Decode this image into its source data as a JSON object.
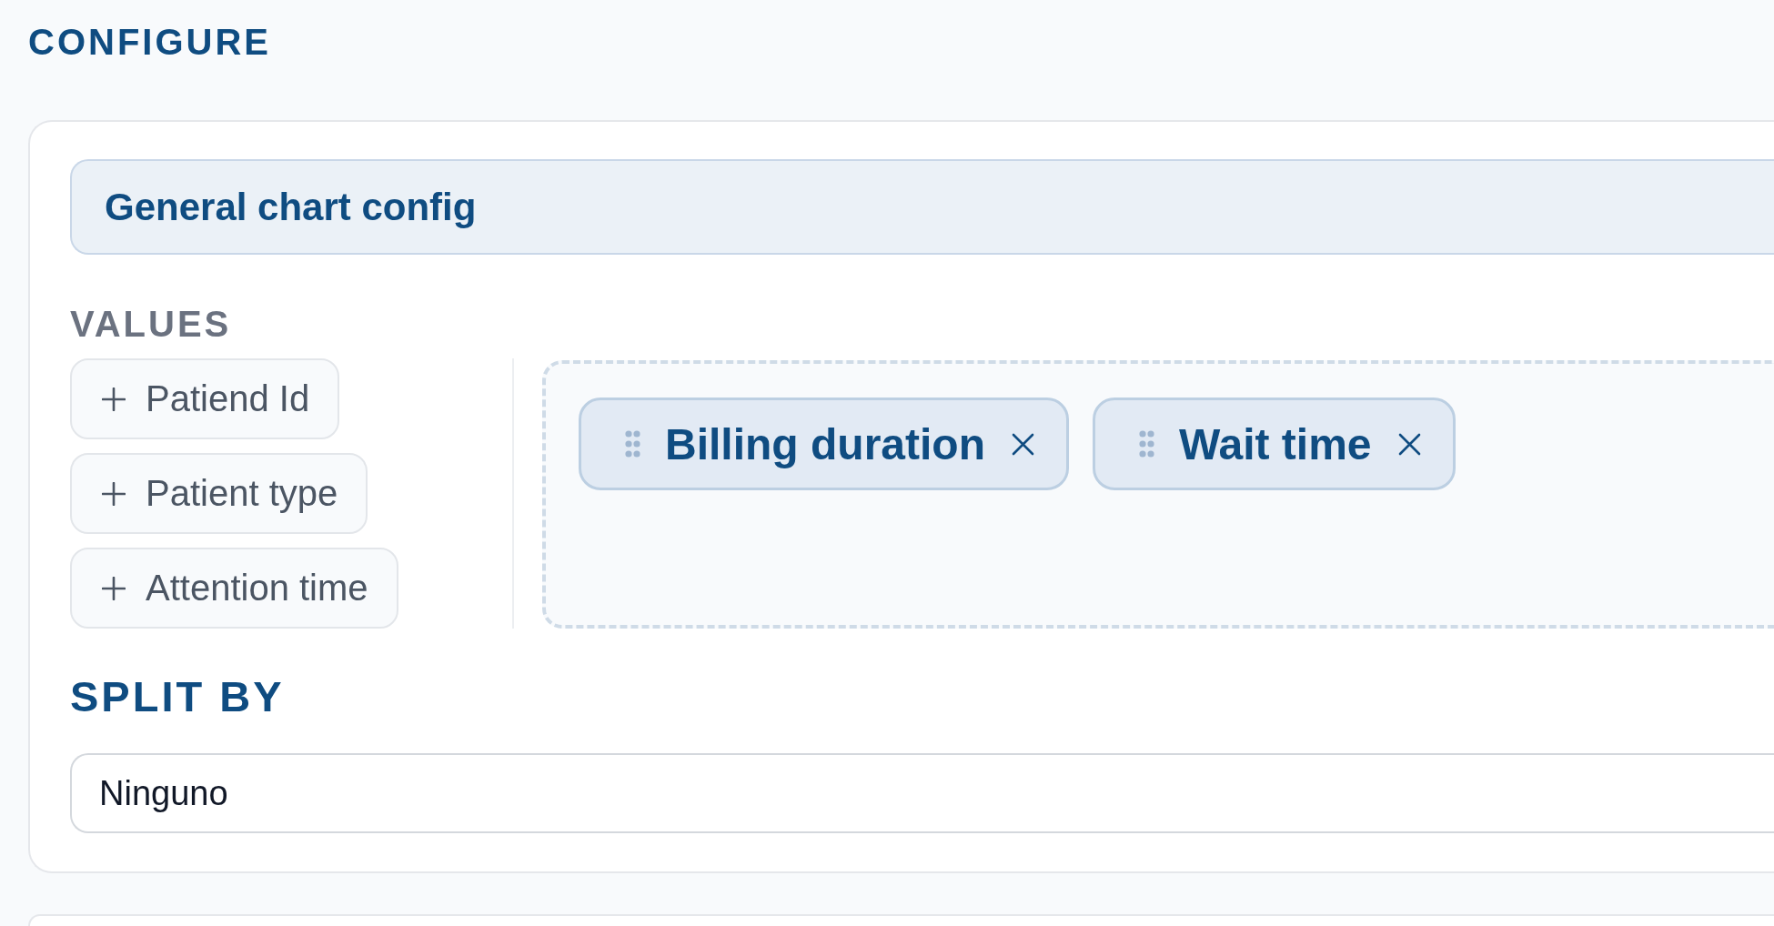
{
  "section_title": "CONFIGURE",
  "panel": {
    "header": "General chart config",
    "values": {
      "label": "VALUES",
      "available_fields": [
        {
          "label": "Patiend Id"
        },
        {
          "label": "Patient type"
        },
        {
          "label": "Attention time"
        }
      ],
      "selected_fields": [
        {
          "label": "Billing duration"
        },
        {
          "label": "Wait time"
        }
      ]
    },
    "split_by": {
      "label": "SPLIT BY",
      "value": "Ninguno"
    }
  }
}
